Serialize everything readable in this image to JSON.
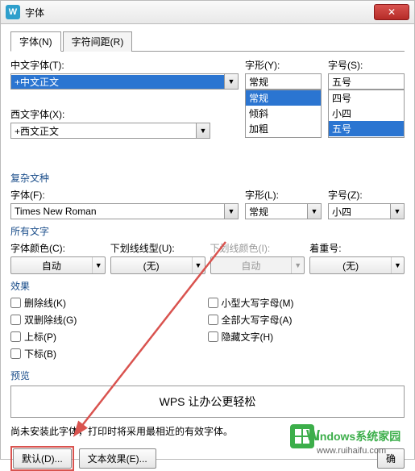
{
  "title": "字体",
  "tabs": {
    "font": "字体(N)",
    "spacing": "字符间距(R)"
  },
  "cn_font": {
    "label": "中文字体(T):",
    "value": "+中文正文"
  },
  "style": {
    "label": "字形(Y):",
    "value": "常规",
    "options": [
      "常规",
      "倾斜",
      "加粗"
    ]
  },
  "size": {
    "label": "字号(S):",
    "value": "五号",
    "options": [
      "四号",
      "小四",
      "五号"
    ]
  },
  "wn_font": {
    "label": "西文字体(X):",
    "value": "+西文正文"
  },
  "complex": {
    "title": "复杂文种",
    "font_label": "字体(F):",
    "font_value": "Times New Roman",
    "style_label": "字形(L):",
    "style_value": "常规",
    "size_label": "字号(Z):",
    "size_value": "小四"
  },
  "alltext": {
    "title": "所有文字",
    "color_label": "字体颜色(C):",
    "color_value": "自动",
    "underline_label": "下划线线型(U):",
    "underline_value": "(无)",
    "ucolor_label": "下划线颜色(I):",
    "ucolor_value": "自动",
    "emph_label": "着重号:",
    "emph_value": "(无)"
  },
  "effects": {
    "title": "效果",
    "strike": "删除线(K)",
    "dblstrike": "双删除线(G)",
    "sup": "上标(P)",
    "sub": "下标(B)",
    "smallcaps": "小型大写字母(M)",
    "allcaps": "全部大写字母(A)",
    "hidden": "隐藏文字(H)"
  },
  "preview": {
    "title": "预览",
    "text": "WPS 让办公更轻松"
  },
  "note": "尚未安装此字体，打印时将采用最相近的有效字体。",
  "buttons": {
    "default": "默认(D)...",
    "texteffect": "文本效果(E)...",
    "ok": "确"
  },
  "watermark": {
    "brand": "indows系统家园",
    "url": "www.ruihaifu.com"
  }
}
